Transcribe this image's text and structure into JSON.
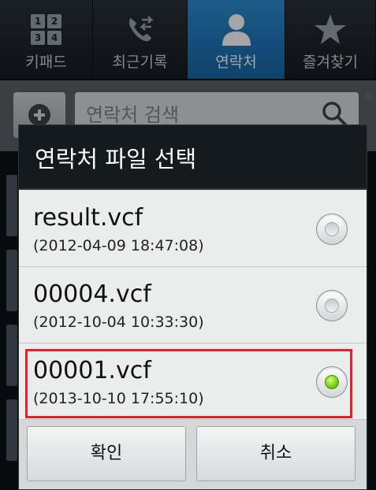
{
  "tabs": [
    {
      "label": "키패드",
      "icon": "keypad-icon",
      "keys": [
        "1",
        "2",
        "3",
        "4"
      ]
    },
    {
      "label": "최근기록",
      "icon": "call-log-icon"
    },
    {
      "label": "연락처",
      "icon": "contact-person-icon",
      "selected": true
    },
    {
      "label": "즐겨찾기",
      "icon": "star-icon"
    }
  ],
  "search": {
    "placeholder": "연락처 검색"
  },
  "scroll_index_char": "#",
  "dialog": {
    "title": "연락처 파일 선택",
    "items": [
      {
        "filename": "result.vcf",
        "date": "(2012-04-09 18:47:08)",
        "selected": false
      },
      {
        "filename": "00004.vcf",
        "date": "(2012-10-04 10:33:30)",
        "selected": false
      },
      {
        "filename": "00001.vcf",
        "date": "(2013-10-10 17:55:10)",
        "selected": true
      }
    ],
    "ok_label": "확인",
    "cancel_label": "취소"
  },
  "colors": {
    "tab_selected": "#1b79bd",
    "highlight": "#e0222d",
    "radio_selected": "#6fcd12"
  }
}
